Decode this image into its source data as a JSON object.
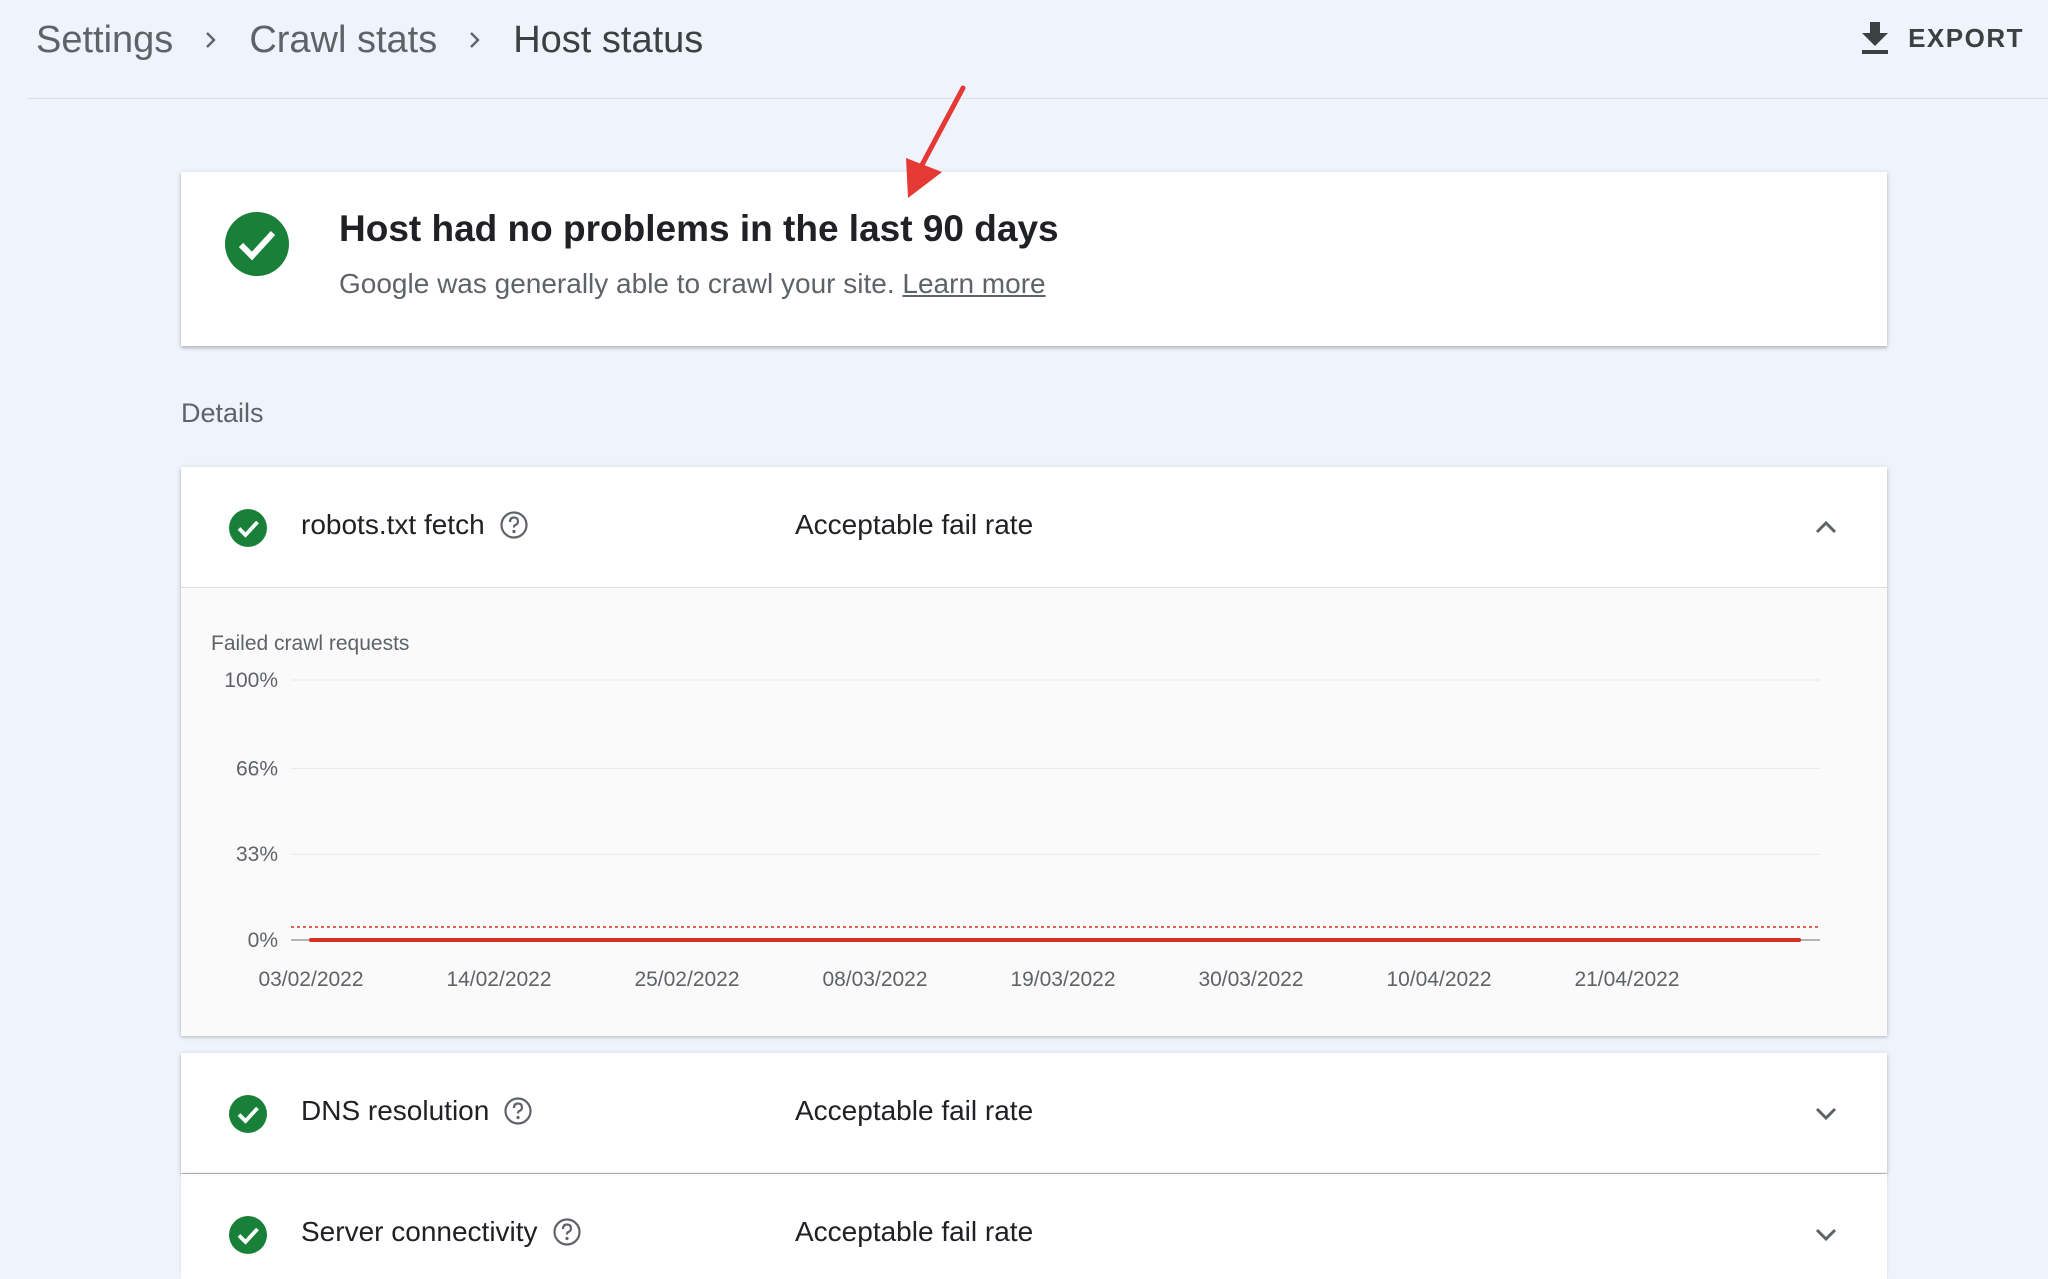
{
  "breadcrumb": {
    "items": [
      "Settings",
      "Crawl stats",
      "Host status"
    ]
  },
  "header": {
    "export_label": "EXPORT",
    "export_icon": "download-icon"
  },
  "status": {
    "title": "Host had no problems in the last 90 days",
    "subtitle": "Google was generally able to crawl your site.",
    "learn_more": "Learn more",
    "icon": "check-circle-icon",
    "color": "#188038"
  },
  "details_label": "Details",
  "checks": [
    {
      "name": "robots.txt fetch",
      "status": "Acceptable fail rate",
      "expanded": true
    },
    {
      "name": "DNS resolution",
      "status": "Acceptable fail rate",
      "expanded": false
    },
    {
      "name": "Server connectivity",
      "status": "Acceptable fail rate",
      "expanded": false
    }
  ],
  "chart_data": {
    "type": "line",
    "title": "Failed crawl requests",
    "y_ticks": [
      "100%",
      "66%",
      "33%",
      "0%"
    ],
    "ylim": [
      0,
      100
    ],
    "x_ticks": [
      "03/02/2022",
      "14/02/2022",
      "25/02/2022",
      "08/03/2022",
      "19/03/2022",
      "30/03/2022",
      "10/04/2022",
      "21/04/2022"
    ],
    "series": [
      {
        "color": "#d93025",
        "values": [
          0,
          0,
          0,
          0,
          0,
          0,
          0,
          0,
          0
        ]
      }
    ],
    "threshold": 5,
    "threshold_style": "dotted",
    "grid": true
  },
  "colors": {
    "accent_green": "#188038",
    "alert_red": "#d93025",
    "background": "#eff3fb"
  }
}
